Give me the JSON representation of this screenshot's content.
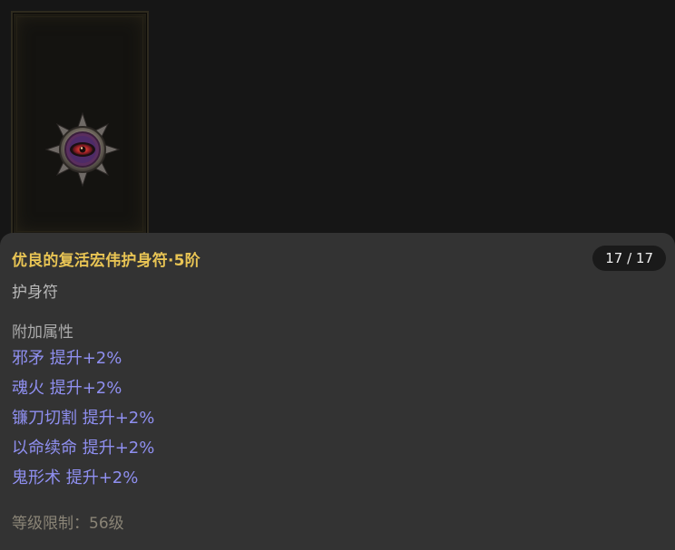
{
  "item": {
    "name": "优良的复活宏伟护身符·5阶",
    "counter": "17 / 17",
    "type": "护身符",
    "section_label": "附加属性",
    "attributes": [
      "邪矛 提升+2%",
      "魂火 提升+2%",
      "镰刀切割 提升+2%",
      "以命续命 提升+2%",
      "鬼形术 提升+2%"
    ],
    "level_requirement": "等级限制：56级",
    "icon": "amulet-icon"
  },
  "colors": {
    "title": "#e8c454",
    "attribute": "#8f8ff0",
    "panel": "#333333",
    "background": "#161616"
  }
}
